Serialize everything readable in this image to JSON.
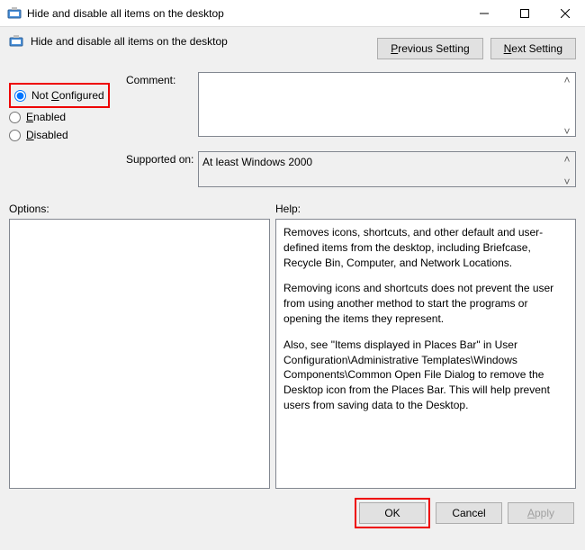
{
  "window": {
    "title": "Hide and disable all items on the desktop"
  },
  "header": {
    "policy_name": "Hide and disable all items on the desktop",
    "prev_label": "Previous Setting",
    "next_label": "Next Setting"
  },
  "state": {
    "not_configured": "Not Configured",
    "enabled": "Enabled",
    "disabled": "Disabled",
    "selected": "not_configured"
  },
  "fields": {
    "comment_label": "Comment:",
    "comment_value": "",
    "supported_label": "Supported on:",
    "supported_value": "At least Windows 2000"
  },
  "sections": {
    "options_label": "Options:",
    "help_label": "Help:"
  },
  "help": {
    "p1": "Removes icons, shortcuts, and other default and user-defined items from the desktop, including Briefcase, Recycle Bin, Computer, and Network Locations.",
    "p2": "Removing icons and shortcuts does not prevent the user from using another method to start the programs or opening the items they represent.",
    "p3": "Also, see \"Items displayed in Places Bar\" in User Configuration\\Administrative Templates\\Windows Components\\Common Open File Dialog to remove the Desktop icon from the Places Bar. This will help prevent users from saving data to the Desktop."
  },
  "footer": {
    "ok": "OK",
    "cancel": "Cancel",
    "apply": "Apply"
  }
}
